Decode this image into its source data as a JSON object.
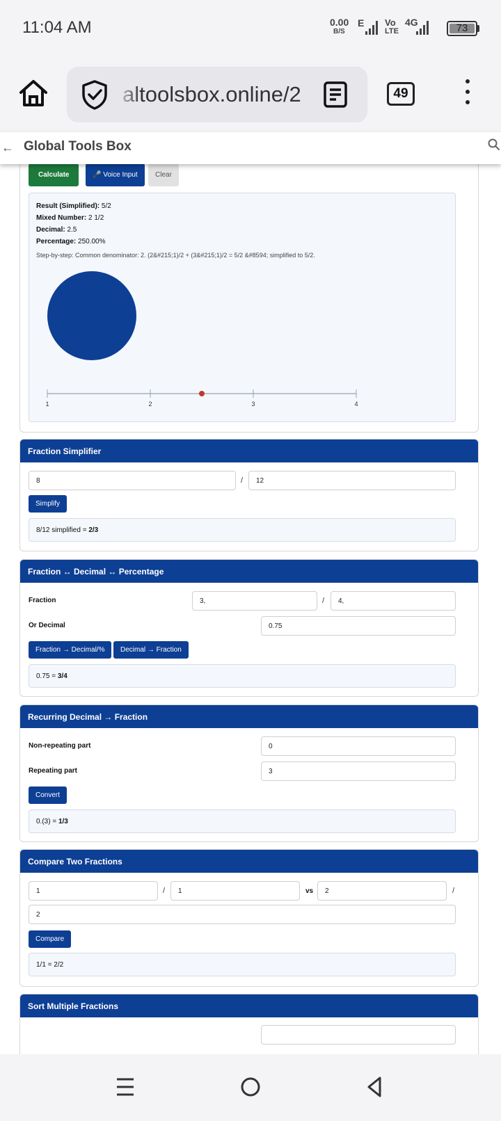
{
  "status_bar": {
    "time": "11:04 AM",
    "net_speed_value": "0.00",
    "net_speed_unit": "B/S",
    "network_e": "E",
    "volte_top": "Vo",
    "volte_bottom": "LTE",
    "network_4g": "4G",
    "battery": "73"
  },
  "browser": {
    "url": "altoolsbox.online/2",
    "tab_count": "49"
  },
  "site": {
    "title": "Global Tools Box"
  },
  "calculator": {
    "buttons": {
      "calculate": "Calculate",
      "voice": "🎤 Voice Input",
      "clear": "Clear"
    },
    "result_simplified_label": "Result (Simplified):",
    "result_simplified_value": "5/2",
    "mixed_label": "Mixed Number:",
    "mixed_value": "2 1/2",
    "decimal_label": "Decimal:",
    "decimal_value": "2.5",
    "percentage_label": "Percentage:",
    "percentage_value": "250.00%",
    "steps": "Step-by-step: Common denominator: 2. (2&#215;1)/2 + (3&#215;1)/2 = 5/2 &#8594; simplified to 5/2.",
    "number_line": {
      "ticks": [
        "1",
        "2",
        "3",
        "4"
      ],
      "min": 1,
      "max": 4,
      "marker": 2.5
    },
    "pie_fill_color": "#0d3f94"
  },
  "simplifier": {
    "title": "Fraction Simplifier",
    "numerator": "8",
    "slash": "/",
    "denominator": "12",
    "button": "Simplify",
    "result_prefix": "8/12 simplified = ",
    "result_value": "2/3"
  },
  "converter": {
    "title": "Fraction ↔ Decimal ↔ Percentage",
    "fraction_label": "Fraction",
    "fraction_num": "3,",
    "slash": "/",
    "fraction_den": "4,",
    "decimal_label": "Or Decimal",
    "decimal_value": "0.75",
    "btn_to_decimal": "Fraction → Decimal/%",
    "btn_to_fraction": "Decimal → Fraction",
    "result_prefix": "0.75 = ",
    "result_value": "3/4"
  },
  "recurring": {
    "title": "Recurring Decimal → Fraction",
    "nonrep_label": "Non-repeating part",
    "nonrep_value": "0",
    "rep_label": "Repeating part",
    "rep_value": "3",
    "button": "Convert",
    "result_prefix": "0.(3) = ",
    "result_value": "1/3"
  },
  "compare": {
    "title": "Compare Two Fractions",
    "a_num": "1",
    "slash": "/",
    "a_den": "1",
    "vs": "vs",
    "b_num": "2",
    "b_den": "2",
    "button": "Compare",
    "result": "1/1 = 2/2"
  },
  "sort": {
    "title": "Sort Multiple Fractions"
  },
  "colors": {
    "brand_blue": "#0d3f94",
    "calculate_green": "#1d7a3c",
    "marker_red": "#c0392b"
  }
}
